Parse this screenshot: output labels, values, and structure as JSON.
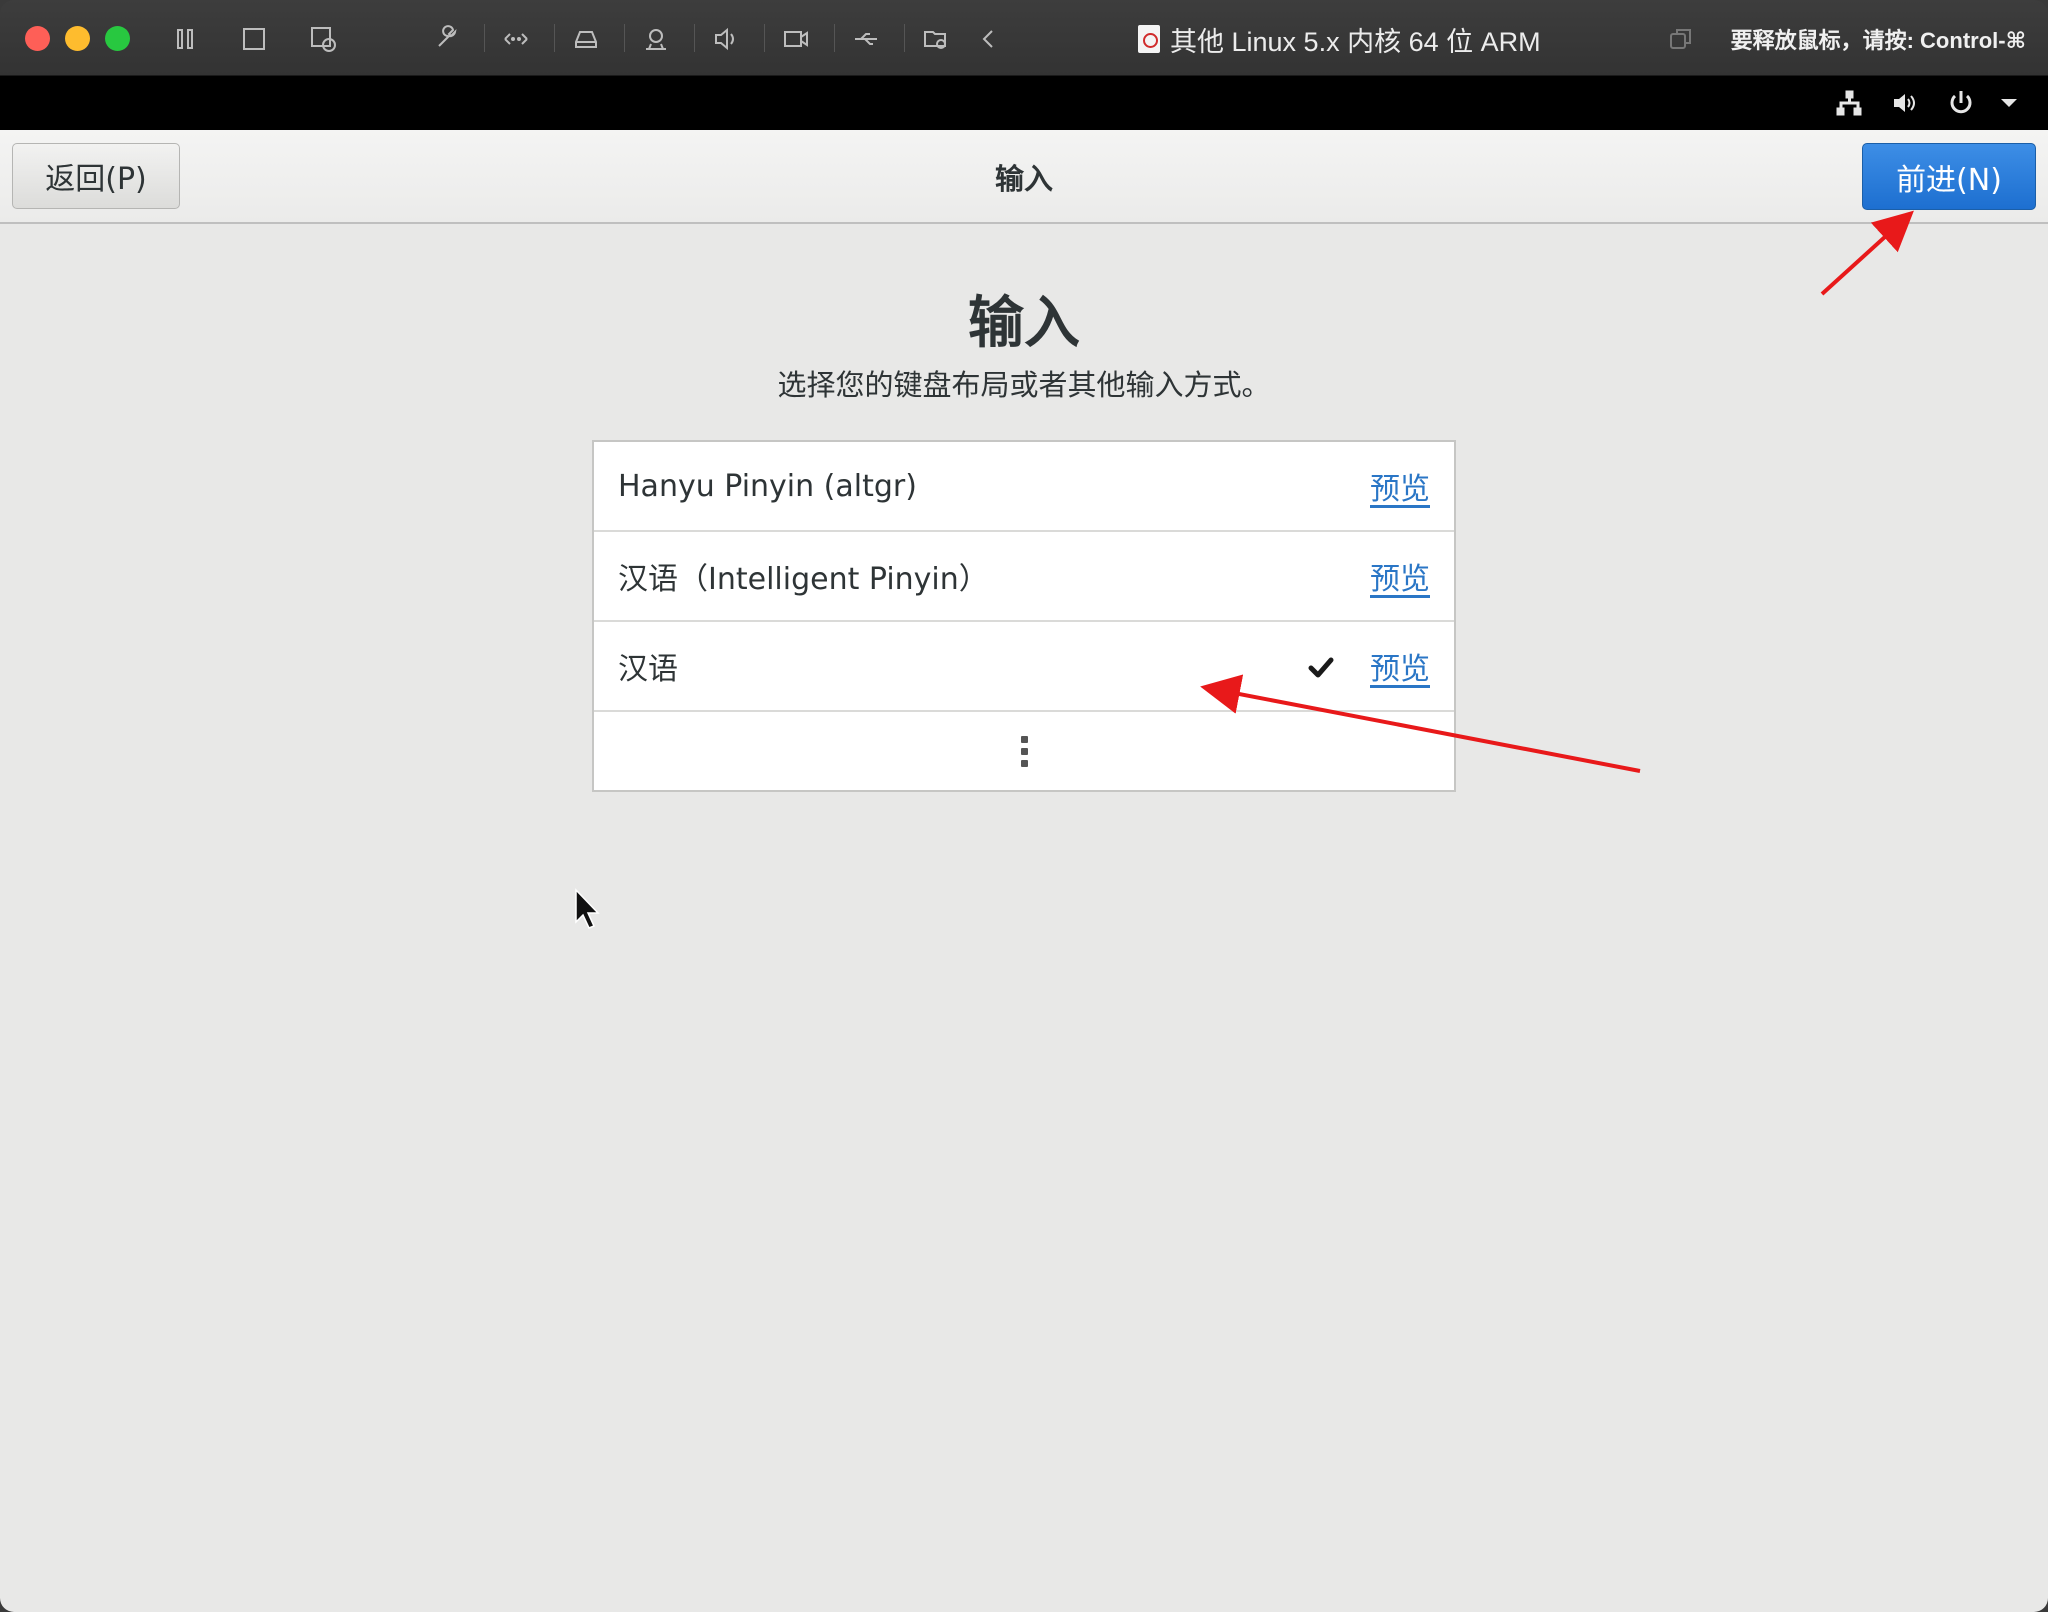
{
  "vm_window": {
    "title": "其他 Linux 5.x 内核 64 位 ARM",
    "release_hint": "要释放鼠标，请按: Control-⌘",
    "toolbar_icons": [
      "pause-icon",
      "stop-icon",
      "snapshot-icon",
      "settings-wrench-icon",
      "network-icon",
      "disk-icon",
      "camera-icon",
      "sound-icon",
      "video-icon",
      "usb-icon",
      "shared-folder-icon",
      "collapse-icon"
    ]
  },
  "guest_panel": {
    "icons": [
      "network-icon",
      "volume-icon",
      "power-icon",
      "dropdown-arrow-icon"
    ]
  },
  "header": {
    "back_label": "返回(P)",
    "title": "输入",
    "next_label": "前进(N)"
  },
  "main": {
    "heading": "输入",
    "subtitle": "选择您的键盘布局或者其他输入方式。",
    "layouts": [
      {
        "name": "Hanyu Pinyin (altgr)",
        "preview": "预览",
        "selected": false
      },
      {
        "name": "汉语（Intelligent Pinyin）",
        "preview": "预览",
        "selected": false
      },
      {
        "name": "汉语",
        "preview": "预览",
        "selected": true
      }
    ]
  },
  "colors": {
    "accent": "#1d6fd0",
    "link": "#2a76c6",
    "annotation": "#e8191a",
    "background": "#e8e8e7"
  }
}
